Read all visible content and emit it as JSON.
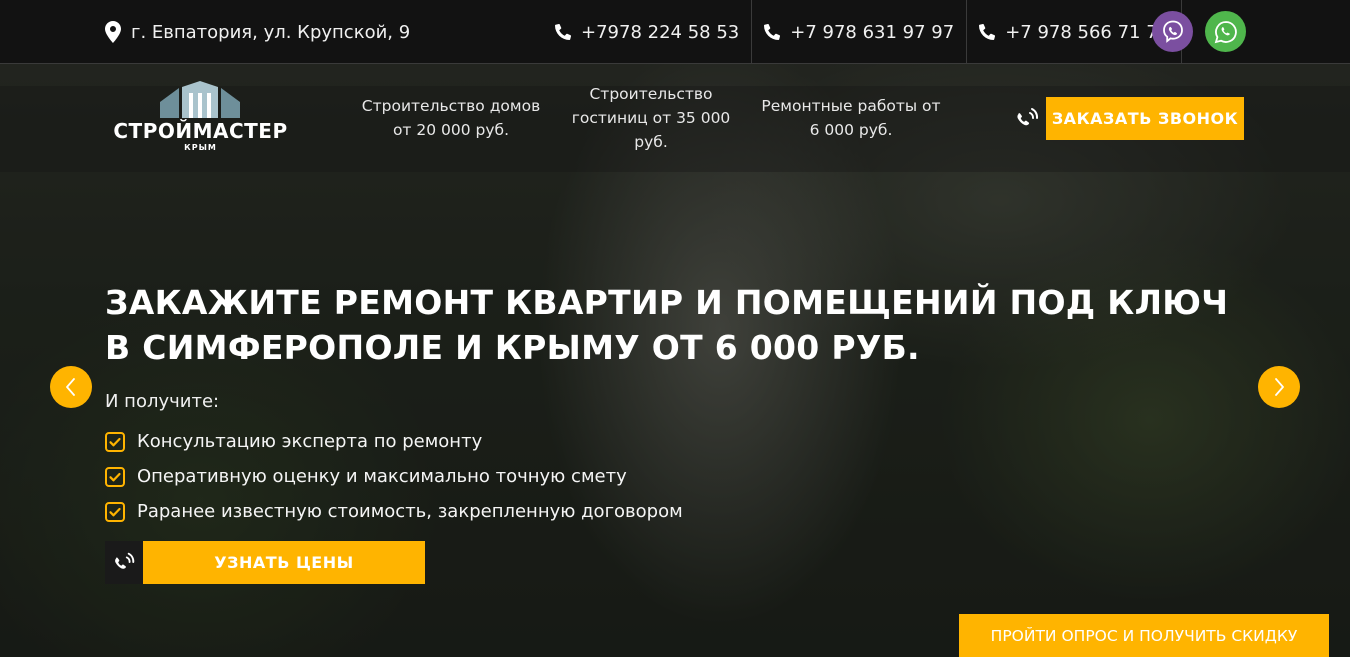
{
  "topbar": {
    "address": "г. Евпатория, ул. Крупской, 9",
    "phones": [
      "+7978 224 58 53",
      "+7 978 631 97 97",
      "+7 978 566 71 70"
    ],
    "messengers": [
      {
        "name": "viber",
        "color": "#7b4fa0"
      },
      {
        "name": "whatsapp",
        "color": "#4fb64c"
      }
    ]
  },
  "header": {
    "logo_text": "СТРОЙМАСТЕР",
    "logo_sub": "КРЫМ",
    "nav": [
      {
        "label": "Строительство домов от 20 000 руб."
      },
      {
        "label": "Строительство гостиниц от 35 000 руб."
      },
      {
        "label": "Ремонтные работы от 6 000 руб."
      }
    ],
    "call_button": "ЗАКАЗАТЬ ЗВОНОК"
  },
  "hero": {
    "title_line1": "Закажите ремонт квартир и помещений под ключ",
    "title_line2": "в Симферополе и Крыму от 6 000 руб.",
    "subhead": "И получите:",
    "benefits": [
      "Консультацию эксперта по ремонту",
      "Оперативную оценку и максимально точную смету",
      "Раранее известную стоимость, закрепленную договором"
    ],
    "cta_button": "УЗНАТЬ ЦЕНЫ",
    "survey_button": "ПРОЙТИ ОПРОС И ПОЛУЧИТЬ СКИДКУ"
  },
  "colors": {
    "accent": "#ffb400",
    "topbar_bg": "#121212"
  },
  "icons": [
    "map-pin-icon",
    "phone-icon",
    "viber-icon",
    "whatsapp-icon",
    "phone-volume-icon",
    "check-square-icon",
    "chevron-left-icon",
    "chevron-right-icon"
  ]
}
